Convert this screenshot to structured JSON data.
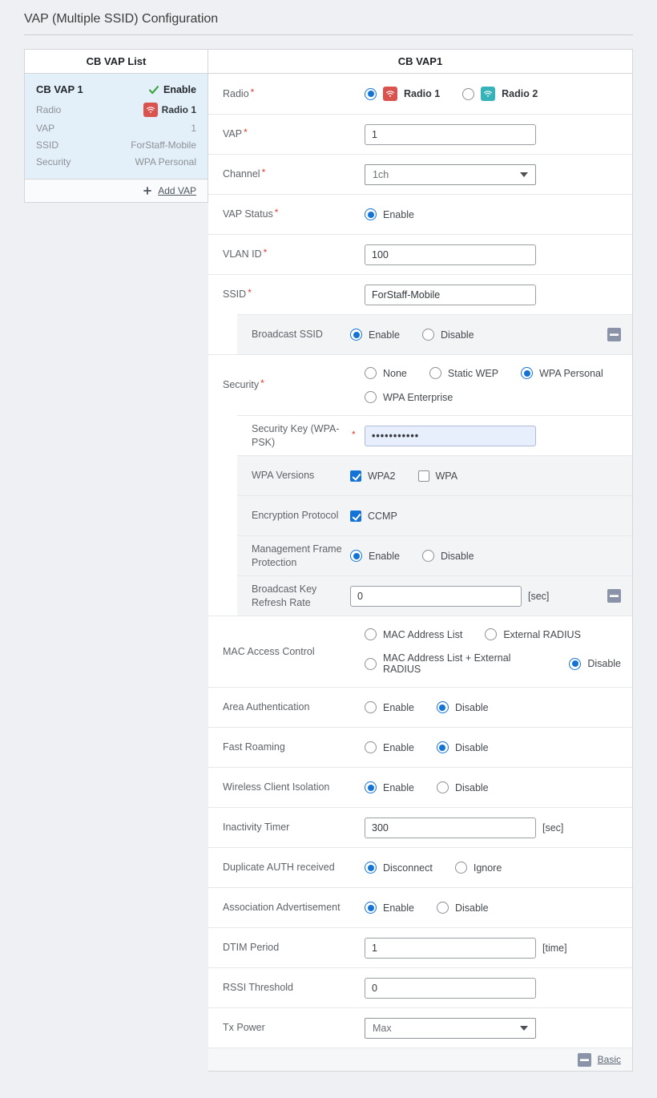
{
  "page": {
    "title": "VAP (Multiple SSID) Configuration"
  },
  "required_marker": "*",
  "colors": {
    "accent_blue": "#1473d6",
    "radio1_badge": "#d9534f",
    "radio2_badge": "#35b3b8",
    "status_green": "#3ba23b",
    "minus_icon": "#8a93a8",
    "selected_card_bg": "#e3eff9",
    "security_key_bg": "#e7effc",
    "page_bg": "#eef0f4"
  },
  "sidebar": {
    "header": "CB VAP List",
    "vap": {
      "name": "CB VAP 1",
      "status": "Enable",
      "fields": [
        {
          "label": "Radio",
          "value": "Radio 1"
        },
        {
          "label": "VAP",
          "value": "1"
        },
        {
          "label": "SSID",
          "value": "ForStaff-Mobile"
        },
        {
          "label": "Security",
          "value": "WPA Personal"
        }
      ]
    },
    "add_vap_label": "Add VAP"
  },
  "main": {
    "header": "CB VAP1",
    "rows": {
      "radio": {
        "label": "Radio",
        "options": [
          {
            "label": "Radio 1",
            "selected": true
          },
          {
            "label": "Radio 2",
            "selected": false
          }
        ]
      },
      "vap": {
        "label": "VAP",
        "value": "1"
      },
      "channel": {
        "label": "Channel",
        "value": "1ch"
      },
      "vap_status": {
        "label": "VAP Status",
        "options": [
          {
            "label": "Enable",
            "selected": true
          }
        ]
      },
      "vlan_id": {
        "label": "VLAN ID",
        "value": "100"
      },
      "ssid": {
        "label": "SSID",
        "value": "ForStaff-Mobile"
      },
      "broadcast_ssid": {
        "label": "Broadcast SSID",
        "options": [
          {
            "label": "Enable",
            "selected": true
          },
          {
            "label": "Disable",
            "selected": false
          }
        ]
      },
      "security": {
        "label": "Security",
        "options": [
          {
            "label": "None",
            "selected": false
          },
          {
            "label": "Static WEP",
            "selected": false
          },
          {
            "label": "WPA Personal",
            "selected": true
          },
          {
            "label": "WPA Enterprise",
            "selected": false
          }
        ]
      },
      "security_key": {
        "label": "Security Key (WPA-PSK)",
        "value": "•••••••••••"
      },
      "wpa_versions": {
        "label": "WPA Versions",
        "options": [
          {
            "label": "WPA2",
            "checked": true
          },
          {
            "label": "WPA",
            "checked": false
          }
        ]
      },
      "encryption_protocol": {
        "label": "Encryption Protocol",
        "options": [
          {
            "label": "CCMP",
            "checked": true
          }
        ]
      },
      "management_frame_protection": {
        "label": "Management Frame Protection",
        "options": [
          {
            "label": "Enable",
            "selected": true
          },
          {
            "label": "Disable",
            "selected": false
          }
        ]
      },
      "broadcast_key_refresh_rate": {
        "label": "Broadcast Key Refresh Rate",
        "value": "0",
        "unit": "[sec]"
      },
      "mac_access_control": {
        "label": "MAC Access Control",
        "options": [
          {
            "label": "MAC Address List",
            "selected": false
          },
          {
            "label": "External RADIUS",
            "selected": false
          },
          {
            "label": "MAC Address List + External RADIUS",
            "selected": false
          },
          {
            "label": "Disable",
            "selected": true
          }
        ]
      },
      "area_authentication": {
        "label": "Area Authentication",
        "options": [
          {
            "label": "Enable",
            "selected": false
          },
          {
            "label": "Disable",
            "selected": true
          }
        ]
      },
      "fast_roaming": {
        "label": "Fast Roaming",
        "options": [
          {
            "label": "Enable",
            "selected": false
          },
          {
            "label": "Disable",
            "selected": true
          }
        ]
      },
      "wireless_client_isolation": {
        "label": "Wireless Client Isolation",
        "options": [
          {
            "label": "Enable",
            "selected": true
          },
          {
            "label": "Disable",
            "selected": false
          }
        ]
      },
      "inactivity_timer": {
        "label": "Inactivity Timer",
        "value": "300",
        "unit": "[sec]"
      },
      "duplicate_auth": {
        "label": "Duplicate AUTH received",
        "options": [
          {
            "label": "Disconnect",
            "selected": true
          },
          {
            "label": "Ignore",
            "selected": false
          }
        ]
      },
      "association_advertisement": {
        "label": "Association Advertisement",
        "options": [
          {
            "label": "Enable",
            "selected": true
          },
          {
            "label": "Disable",
            "selected": false
          }
        ]
      },
      "dtim_period": {
        "label": "DTIM Period",
        "value": "1",
        "unit": "[time]"
      },
      "rssi_threshold": {
        "label": "RSSI Threshold",
        "value": "0"
      },
      "tx_power": {
        "label": "Tx Power",
        "value": "Max"
      }
    },
    "footer": {
      "basic_label": "Basic"
    }
  }
}
